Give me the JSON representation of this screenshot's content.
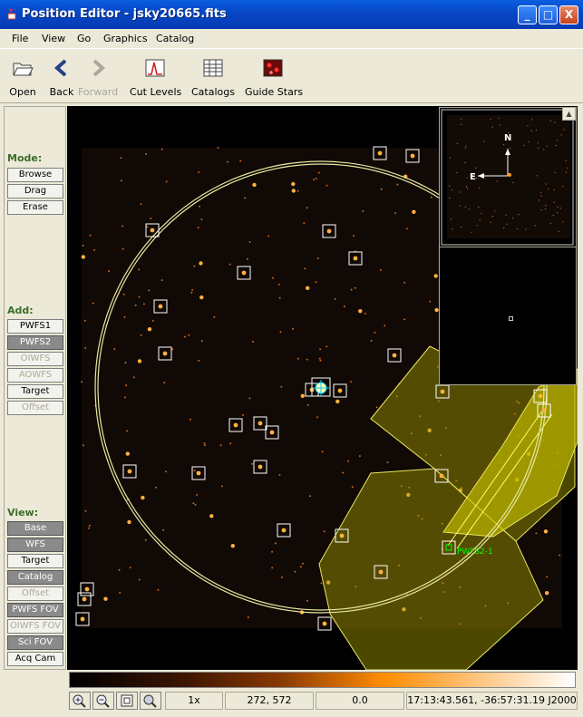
{
  "window": {
    "title": "Position Editor - jsky20665.fits",
    "minimize_glyph": "_",
    "maximize_glyph": "□",
    "close_glyph": "X",
    "icon": "app-icon"
  },
  "menu": [
    "File",
    "View",
    "Go",
    "Graphics",
    "Catalog"
  ],
  "toolbar": {
    "open": "Open",
    "back": "Back",
    "forward": "Forward",
    "cut_levels": "Cut Levels",
    "catalogs": "Catalogs",
    "guide_stars": "Guide Stars"
  },
  "mode": {
    "label": "Mode:",
    "buttons": [
      "Browse",
      "Drag",
      "Erase"
    ]
  },
  "add": {
    "label": "Add:",
    "buttons": [
      "PWFS1",
      "PWFS2",
      "OIWFS",
      "AOWFS",
      "Target",
      "Offset"
    ]
  },
  "view": {
    "label": "View:",
    "buttons": [
      "Base",
      "WFS",
      "Target",
      "Catalog",
      "Offset",
      "PWFS FOV",
      "OIWFS FOV",
      "Sci FOV",
      "Acq Cam"
    ]
  },
  "panner": {
    "north": "N",
    "east": "E"
  },
  "image": {
    "guide_label": "PWFS2-1"
  },
  "status": {
    "zoom": "1x",
    "pixel": "272, 572",
    "value": "0.0",
    "wcs": "17:13:43.561, -36:57:31.19 J2000"
  },
  "colors": {
    "title_bar": "#0747c7",
    "section_label": "#3a6e2a",
    "overlay_yellow": "#ffff66",
    "guide_label": "#00ff00"
  }
}
